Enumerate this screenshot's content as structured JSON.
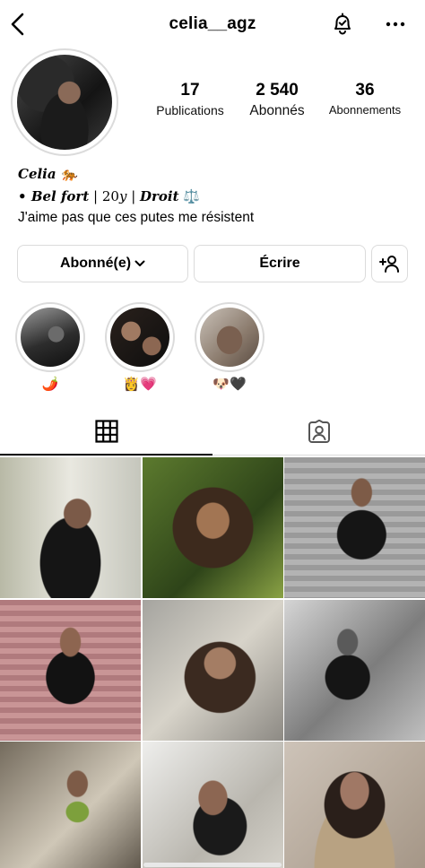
{
  "header": {
    "username": "celia__agz",
    "back_icon": "chevron-left-icon",
    "bell_icon": "notification-bell-check-icon",
    "more_icon": "more-horizontal-icon"
  },
  "profile": {
    "avatar": "profile-photo",
    "stats": [
      {
        "value": "17",
        "label": "Publications"
      },
      {
        "value": "2 540",
        "label": "Abonnés"
      },
      {
        "value": "36",
        "label": "Abonnements"
      }
    ]
  },
  "bio": {
    "name": "Celia",
    "name_emoji": "🐅",
    "line2_prefix": "• ",
    "line2_city": "Bel fort",
    "line2_sep1": " | 20",
    "line2_y": "y",
    "line2_sep2": " | ",
    "line2_sign": "Droit",
    "line2_emoji": "⚖️",
    "line3": "J'aime pas que ces putes me résistent"
  },
  "actions": {
    "follow_label": "Abonné(e)",
    "message_label": "Écrire",
    "add_user_icon": "add-user-icon"
  },
  "highlights": [
    {
      "label": "🌶️"
    },
    {
      "label": "👸💗"
    },
    {
      "label": "🐶🖤"
    }
  ],
  "tabs": [
    {
      "icon": "grid-icon",
      "active": true
    },
    {
      "icon": "tagged-person-icon",
      "active": false
    }
  ],
  "colors": {
    "border": "#dbdbdb",
    "text": "#000000",
    "background": "#ffffff"
  }
}
